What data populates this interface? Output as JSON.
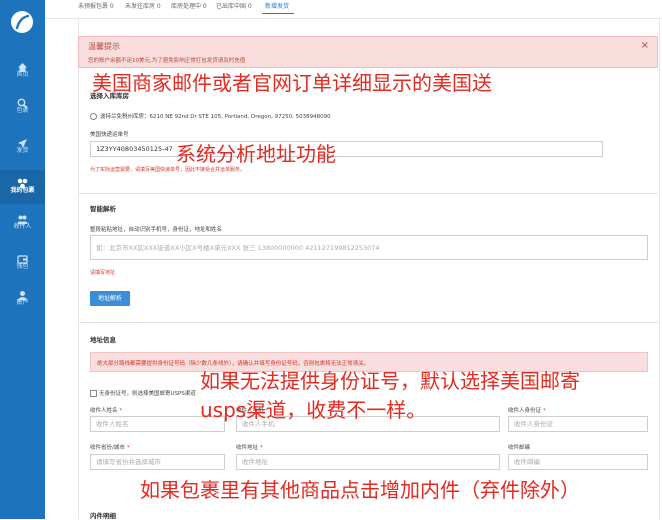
{
  "sidebar": {
    "logo": "logo-icon",
    "items": [
      {
        "label": "首页",
        "icon": "home-icon"
      },
      {
        "label": "包裹",
        "icon": "search-icon"
      },
      {
        "label": "发货",
        "icon": "paper-plane-icon"
      },
      {
        "label": "我的包裹",
        "icon": "packages-icon",
        "active": true
      },
      {
        "label": "收件人",
        "icon": "people-icon"
      },
      {
        "label": "钱包",
        "icon": "wallet-icon"
      },
      {
        "label": "账户",
        "icon": "user-icon"
      }
    ]
  },
  "tabs": [
    "未预报包裹 0",
    "未发往库房 0",
    "库房处理中 0",
    "已出库中国 0",
    "新增发货"
  ],
  "active_tab": "新增发货",
  "alert": {
    "title": "温馨提示",
    "message": "您的账户余额不足10美元,为了避免影响正常打包发货请及时充值",
    "close": "×"
  },
  "warehouse": {
    "title": "选择入库库房",
    "option": "波特兰免税州库房：6210 NE 92nd Dr STE 105, Portland, Oregon, 97250, 5038948090"
  },
  "tracking": {
    "label": "美国快递运单号",
    "value": "1Z3YY40803450125-47",
    "hint": "为了实际运营需要，请填写美国快递单号，因此不接受合并运单服务。"
  },
  "smart_parse": {
    "title": "智能解析",
    "instruction": "整段粘贴地址，自动识别手机号，身份证，地址和姓名",
    "placeholder": "如：北京市XX区XXX街道XX小区X号楼X单元XXX 张三 13800000000 421127199812253074",
    "error": "请填写地址",
    "button": "地址解析"
  },
  "address": {
    "title": "地址信息",
    "warning": "绝大部分路线都需要提供身份证号码（除少数几条线外），请确认并填写身份证号码，否则包裹将无法正常清关。",
    "no_id_option": "无身份证号，则选择美国邮寄USPS渠道",
    "required_mark": "*",
    "fields": [
      {
        "label": "收件人姓名",
        "placeholder": "收件人姓名"
      },
      {
        "label": "收件人手机",
        "placeholder": "收件人手机"
      },
      {
        "label": "收件人身份证",
        "placeholder": "收件人身份证"
      },
      {
        "label": "收件省份/城市",
        "placeholder": "请填写省份并选择城市"
      },
      {
        "label": "收件地址",
        "placeholder": "收件地址"
      },
      {
        "label": "收件邮编",
        "placeholder": "收件邮编"
      }
    ]
  },
  "items_section": {
    "title": "内件明细"
  },
  "annotations": [
    "美国商家邮件或者官网订单详细显示的美国送",
    "系统分析地址功能",
    "如果无法提供身份证号，默认选择美国邮寄",
    "usps渠道，收费不一样。",
    "如果包裹里有其他商品点击增加内件（弃件除外）"
  ],
  "colors": {
    "sidebar": "#1e74bc",
    "accent": "#2a7cc7",
    "annotation": "#e42a20",
    "alert_bg": "#f9dcdc"
  }
}
